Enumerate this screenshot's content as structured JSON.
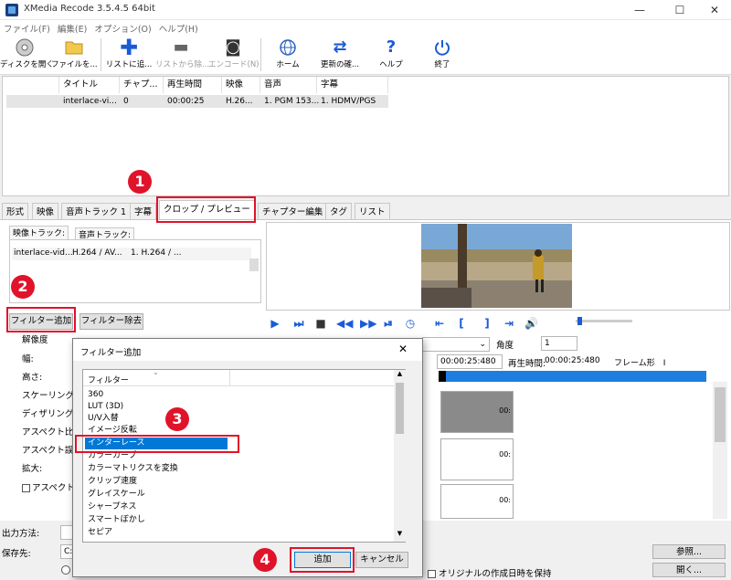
{
  "window": {
    "title": "XMedia Recode 3.5.4.5 64bit",
    "min": "—",
    "max": "☐",
    "close": "✕"
  },
  "menu": [
    "ファイル(F)",
    "編集(E)",
    "オプション(O)",
    "ヘルプ(H)"
  ],
  "toolbar": {
    "open_disc": "ディスクを開く",
    "open_file": "ファイルを...",
    "add_list": "リストに追...",
    "remove_list": "リストから除...",
    "encode": "エンコード(N)",
    "home": "ホーム",
    "update": "更新の確...",
    "help": "ヘルプ",
    "exit": "終了"
  },
  "filelist": {
    "headers": [
      "タイトル",
      "チャプ...",
      "再生時間",
      "映像",
      "音声",
      "字幕"
    ],
    "row": [
      "interlace-vi...",
      "0",
      "00:00:25",
      "H.26...",
      "1. PGM 153...",
      "1. HDMV/PGS"
    ]
  },
  "tabs": [
    "形式",
    "映像",
    "音声トラック 1",
    "字幕",
    "クロップ / プレビュー",
    "チャプター編集",
    "タグ",
    "リスト"
  ],
  "subtabs": [
    "映像トラック:",
    "音声トラック:"
  ],
  "minilist": {
    "row": [
      "interlace-vid...",
      "H.264 / AV...",
      "1. H.264 / ..."
    ]
  },
  "buttons": {
    "add_filter": "フィルター追加",
    "remove_filter": "フィルター除去"
  },
  "left_labels": [
    "解像度",
    "幅:",
    "高さ:",
    "スケーリング",
    "ディザリング",
    "アスペクト比",
    "アスペクト誤",
    "拡大:",
    "アスペクト"
  ],
  "preview": {
    "angle_label": "角度",
    "angle_value": "1",
    "time_value": "00:00:25:480",
    "play_time_label": "再生時間:",
    "play_time": "00:00:25:480",
    "frame_label": "フレーム形　I",
    "seg_time": "00:"
  },
  "bottom": {
    "output_label": "出力方法:",
    "dest_label": "保存先:",
    "dest_value": "C:",
    "browse": "参照...",
    "open": "開く...",
    "keep_date": "オリジナルの作成日時を保持"
  },
  "dialog": {
    "title": "フィルター追加",
    "column": "フィルター",
    "items": [
      "360",
      "LUT (3D)",
      "U/V入替",
      "イメージ反転",
      "インターレース",
      "カラーカーブ",
      "カラーマトリクスを変換",
      "クリップ速度",
      "グレイスケール",
      "シャープネス",
      "スマートぼかし",
      "セピア"
    ],
    "selected_index": 4,
    "add": "追加",
    "cancel": "キャンセル"
  },
  "badges": [
    "1",
    "2",
    "3",
    "4"
  ],
  "colors": {
    "accent": "#0078d7",
    "highlight": "#e0132a",
    "timeline": "#1f7de0"
  }
}
